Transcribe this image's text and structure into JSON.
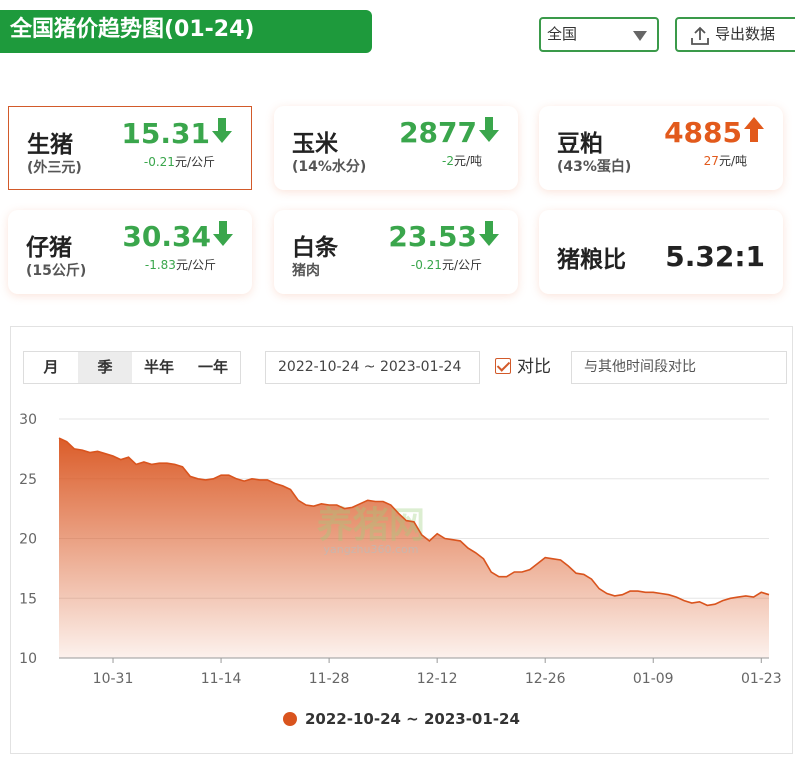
{
  "header": {
    "title": "全国猪价趋势图(01-24)",
    "region": "全国",
    "export_label": "导出数据"
  },
  "cards": [
    {
      "name": "生猪",
      "sub": "(外三元)",
      "price": "15.31",
      "direction": "down",
      "change": "-0.21",
      "unit": "元/公斤",
      "active": true
    },
    {
      "name": "玉米",
      "sub": "(14%水分)",
      "price": "2877",
      "direction": "down",
      "change": "-2",
      "unit": "元/吨"
    },
    {
      "name": "豆粕",
      "sub": "(43%蛋白)",
      "price": "4885",
      "direction": "up",
      "change": "27",
      "unit": "元/吨"
    },
    {
      "name": "仔猪",
      "sub": "(15公斤)",
      "price": "30.34",
      "direction": "down",
      "change": "-1.83",
      "unit": "元/公斤"
    },
    {
      "name": "白条",
      "sub": "猪肉",
      "price": "23.53",
      "direction": "down",
      "change": "-0.21",
      "unit": "元/公斤"
    },
    {
      "name": "猪粮比",
      "ratio": "5.32:1"
    }
  ],
  "controls": {
    "tabs": [
      "月",
      "季",
      "半年",
      "一年"
    ],
    "selected_tab": 1,
    "date_range": "2022-10-24 ~ 2023-01-24",
    "compare_label": "对比",
    "compare_checked": true,
    "compare_placeholder": "与其他时间段对比"
  },
  "watermark": {
    "text": "养猪网",
    "url": "yangzhu360.com"
  },
  "colors": {
    "accent_green": "#1e9a3c",
    "down": "#3aa64c",
    "up": "#e25a1c",
    "series": "#d9541e"
  },
  "chart_data": {
    "type": "area",
    "x_range": [
      "2022-10-24",
      "2023-01-24"
    ],
    "ylim": [
      10,
      30
    ],
    "yticks": [
      10,
      15,
      20,
      25,
      30
    ],
    "xticks": [
      {
        "label": "10-31",
        "date": "2022-10-31"
      },
      {
        "label": "11-14",
        "date": "2022-11-14"
      },
      {
        "label": "11-28",
        "date": "2022-11-28"
      },
      {
        "label": "12-12",
        "date": "2022-12-12"
      },
      {
        "label": "12-26",
        "date": "2022-12-26"
      },
      {
        "label": "01-09",
        "date": "2023-01-09"
      },
      {
        "label": "01-23",
        "date": "2023-01-23"
      }
    ],
    "grid": true,
    "legend_position": "bottom-center",
    "series": [
      {
        "name": "2022-10-24 ~ 2023-01-24",
        "points": [
          [
            "2022-10-24",
            28.4
          ],
          [
            "2022-10-25",
            28.1
          ],
          [
            "2022-10-26",
            27.5
          ],
          [
            "2022-10-27",
            27.4
          ],
          [
            "2022-10-28",
            27.2
          ],
          [
            "2022-10-29",
            27.3
          ],
          [
            "2022-10-30",
            27.1
          ],
          [
            "2022-10-31",
            26.9
          ],
          [
            "2022-11-01",
            26.6
          ],
          [
            "2022-11-02",
            26.8
          ],
          [
            "2022-11-03",
            26.2
          ],
          [
            "2022-11-04",
            26.4
          ],
          [
            "2022-11-05",
            26.2
          ],
          [
            "2022-11-06",
            26.3
          ],
          [
            "2022-11-07",
            26.3
          ],
          [
            "2022-11-08",
            26.2
          ],
          [
            "2022-11-09",
            26.0
          ],
          [
            "2022-11-10",
            25.2
          ],
          [
            "2022-11-11",
            25.0
          ],
          [
            "2022-11-12",
            24.9
          ],
          [
            "2022-11-13",
            25.0
          ],
          [
            "2022-11-14",
            25.3
          ],
          [
            "2022-11-15",
            25.3
          ],
          [
            "2022-11-16",
            25.0
          ],
          [
            "2022-11-17",
            24.8
          ],
          [
            "2022-11-18",
            25.0
          ],
          [
            "2022-11-19",
            24.9
          ],
          [
            "2022-11-20",
            24.9
          ],
          [
            "2022-11-21",
            24.6
          ],
          [
            "2022-11-22",
            24.4
          ],
          [
            "2022-11-23",
            24.1
          ],
          [
            "2022-11-24",
            23.2
          ],
          [
            "2022-11-25",
            22.8
          ],
          [
            "2022-11-26",
            22.7
          ],
          [
            "2022-11-27",
            22.9
          ],
          [
            "2022-11-28",
            22.8
          ],
          [
            "2022-11-29",
            22.8
          ],
          [
            "2022-11-30",
            22.5
          ],
          [
            "2022-12-01",
            22.6
          ],
          [
            "2022-12-02",
            22.9
          ],
          [
            "2022-12-03",
            23.2
          ],
          [
            "2022-12-04",
            23.1
          ],
          [
            "2022-12-05",
            23.1
          ],
          [
            "2022-12-06",
            22.8
          ],
          [
            "2022-12-07",
            22.1
          ],
          [
            "2022-12-08",
            21.5
          ],
          [
            "2022-12-09",
            21.4
          ],
          [
            "2022-12-10",
            20.3
          ],
          [
            "2022-12-11",
            19.8
          ],
          [
            "2022-12-12",
            20.4
          ],
          [
            "2022-12-13",
            20.0
          ],
          [
            "2022-12-14",
            19.9
          ],
          [
            "2022-12-15",
            19.8
          ],
          [
            "2022-12-16",
            19.2
          ],
          [
            "2022-12-17",
            18.8
          ],
          [
            "2022-12-18",
            18.3
          ],
          [
            "2022-12-19",
            17.2
          ],
          [
            "2022-12-20",
            16.8
          ],
          [
            "2022-12-21",
            16.8
          ],
          [
            "2022-12-22",
            17.2
          ],
          [
            "2022-12-23",
            17.2
          ],
          [
            "2022-12-24",
            17.4
          ],
          [
            "2022-12-25",
            17.9
          ],
          [
            "2022-12-26",
            18.4
          ],
          [
            "2022-12-27",
            18.3
          ],
          [
            "2022-12-28",
            18.2
          ],
          [
            "2022-12-29",
            17.7
          ],
          [
            "2022-12-30",
            17.1
          ],
          [
            "2022-12-31",
            17.0
          ],
          [
            "2023-01-01",
            16.6
          ],
          [
            "2023-01-02",
            15.8
          ],
          [
            "2023-01-03",
            15.4
          ],
          [
            "2023-01-04",
            15.2
          ],
          [
            "2023-01-05",
            15.3
          ],
          [
            "2023-01-06",
            15.6
          ],
          [
            "2023-01-07",
            15.6
          ],
          [
            "2023-01-08",
            15.5
          ],
          [
            "2023-01-09",
            15.5
          ],
          [
            "2023-01-10",
            15.4
          ],
          [
            "2023-01-11",
            15.3
          ],
          [
            "2023-01-12",
            15.1
          ],
          [
            "2023-01-13",
            14.8
          ],
          [
            "2023-01-14",
            14.6
          ],
          [
            "2023-01-15",
            14.7
          ],
          [
            "2023-01-16",
            14.4
          ],
          [
            "2023-01-17",
            14.5
          ],
          [
            "2023-01-18",
            14.8
          ],
          [
            "2023-01-19",
            15.0
          ],
          [
            "2023-01-20",
            15.1
          ],
          [
            "2023-01-21",
            15.2
          ],
          [
            "2023-01-22",
            15.1
          ],
          [
            "2023-01-23",
            15.5
          ],
          [
            "2023-01-24",
            15.3
          ]
        ]
      }
    ]
  }
}
